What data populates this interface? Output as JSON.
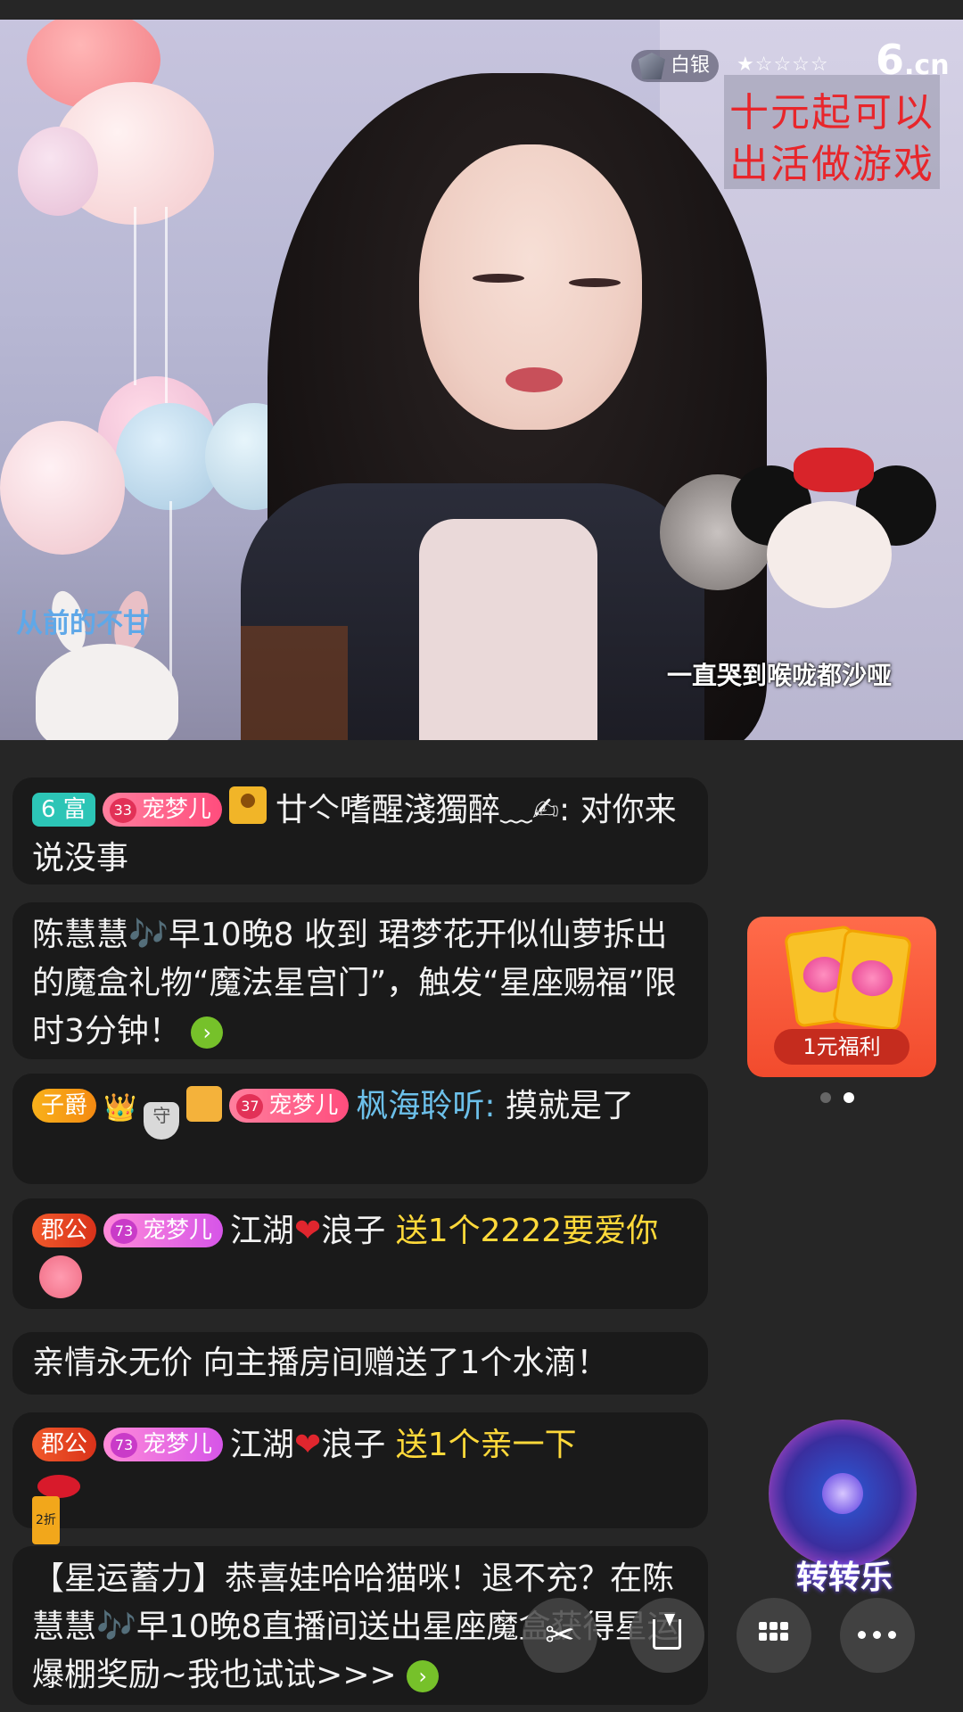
{
  "video": {
    "rank_label": "白银",
    "stars": "★☆☆☆☆",
    "logo_main": "6",
    "logo_suffix": ".cn",
    "promo_line1": "十元起可以",
    "promo_line2": "出活做游戏",
    "song_title": "从前的不甘",
    "lyric": "一直哭到喉咙都沙哑"
  },
  "chat": {
    "messages": [
      {
        "badge_rich": "6 富",
        "pet_level": "33",
        "pet_label": "宠梦儿",
        "username": "廿亽嗜醒淺獨醉﹏✍",
        "text": ": 对你来说没事"
      },
      {
        "text": "陈慧慧🎶早10晚8 收到 珺梦花开似仙萝拆出的魔盒礼物“魔法星宫门”，触发“星座赐福”限时3分钟！",
        "go": "›"
      },
      {
        "badge_title": "子爵",
        "crown": "👑",
        "shield_text": "守",
        "pet_level": "37",
        "pet_label": "宠梦儿",
        "username": "枫海聆听:",
        "text": " 摸就是了"
      },
      {
        "badge_title": "郡公",
        "pet_level": "73",
        "pet_label": "宠梦儿",
        "username_a": "江湖",
        "heart": "❤",
        "username_b": "浪子",
        "gift_text": "送1个2222要爱你"
      },
      {
        "text": "亲情永无价 向主播房间赠送了1个水滴！"
      },
      {
        "badge_title": "郡公",
        "pet_level": "73",
        "pet_label": "宠梦儿",
        "username_a": "江湖",
        "heart": "❤",
        "username_b": "浪子",
        "gift_text": "送1个亲一下",
        "gift_tag": "2折"
      },
      {
        "text": "【星运蓄力】恭喜娃哈哈猫咪！退不充？在陈慧慧🎶早10晚8直播间送出星座魔盒获得星运爆棚奖励~我也试试>>>",
        "go": "›"
      }
    ]
  },
  "widgets": {
    "welfare_label": "1元福利",
    "spin_label": "转转乐"
  },
  "toolbar": {
    "share_glyph": "✂",
    "download_icon": "download-icon",
    "grid_icon": "grid-icon",
    "more_icon": "more-icon"
  },
  "colors": {
    "background": "#262626",
    "bubble": "#1a1a1a",
    "gift_text": "#ffd93a",
    "username_blue": "#6cc0ea",
    "promo_red": "#e8262b"
  }
}
